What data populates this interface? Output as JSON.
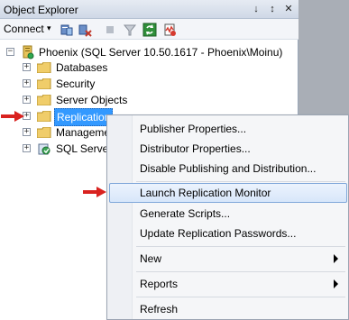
{
  "window": {
    "title": "Object Explorer",
    "pin_glyph": "↓",
    "autohide_glyph": "↕",
    "close_glyph": "✕"
  },
  "toolbar": {
    "connect_label": "Connect",
    "connect_arrow": "▾",
    "icons": [
      "connect-server-icon",
      "disconnect-icon",
      "stop-icon",
      "filter-icon",
      "refresh-icon",
      "activity-monitor-icon"
    ]
  },
  "tree": {
    "root": {
      "label": "Phoenix (SQL Server 10.50.1617 - Phoenix\\Moinu)",
      "expander": "−"
    },
    "children": [
      {
        "label": "Databases",
        "expander": "+"
      },
      {
        "label": "Security",
        "expander": "+"
      },
      {
        "label": "Server Objects",
        "expander": "+"
      },
      {
        "label": "Replication",
        "expander": "+",
        "selected": true
      },
      {
        "label": "Management",
        "expander": "+"
      },
      {
        "label": "SQL Server Agent",
        "expander": "+"
      }
    ]
  },
  "context_menu": {
    "items": [
      {
        "label": "Publisher Properties..."
      },
      {
        "label": "Distributor Properties..."
      },
      {
        "label": "Disable Publishing and Distribution..."
      },
      {
        "label": "Launch Replication Monitor",
        "highlighted": true
      },
      {
        "label": "Generate Scripts..."
      },
      {
        "label": "Update Replication Passwords..."
      },
      {
        "label": "New",
        "submenu": true
      },
      {
        "label": "Reports",
        "submenu": true
      },
      {
        "label": "Refresh"
      }
    ]
  },
  "colors": {
    "selection": "#3399ff",
    "annotation_arrow": "#d9221f",
    "menu_highlight_border": "#7fa7d9"
  }
}
